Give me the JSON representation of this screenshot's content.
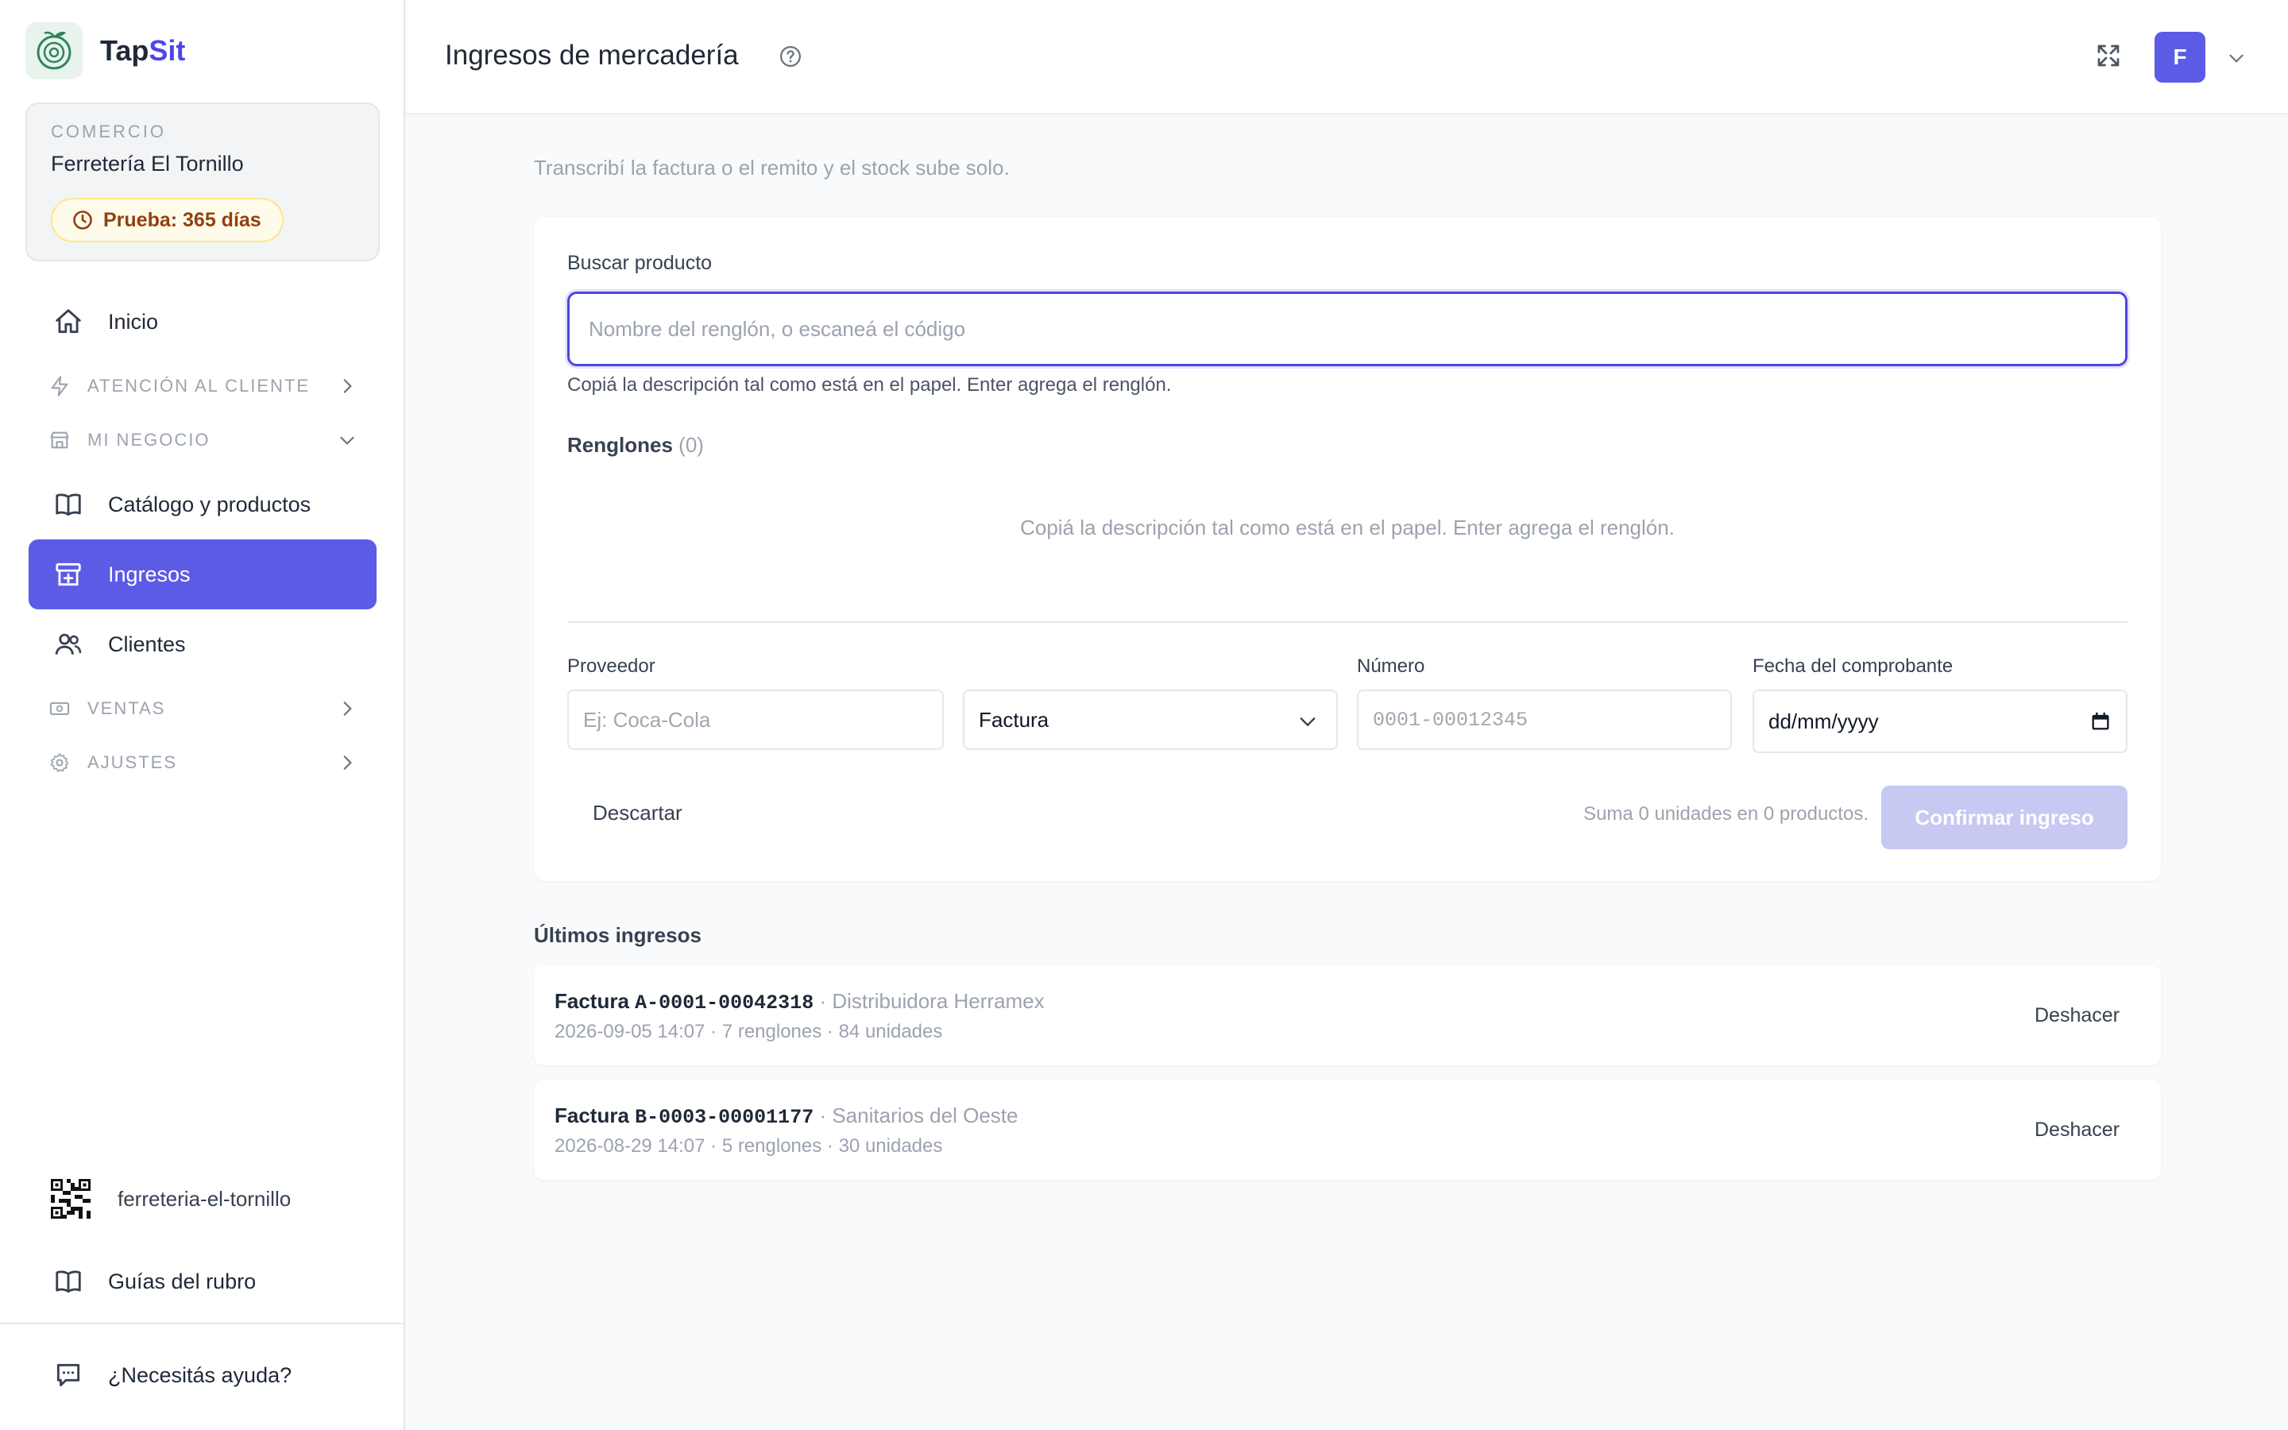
{
  "brand": {
    "name_part1": "Tap",
    "name_part2": "Sit"
  },
  "store": {
    "label": "COMERCIO",
    "name": "Ferretería El Tornillo",
    "trial": "Prueba: 365 días"
  },
  "nav": {
    "inicio": "Inicio",
    "atencion": "ATENCIÓN AL CLIENTE",
    "negocio": "MI NEGOCIO",
    "catalogo": "Catálogo y productos",
    "ingresos": "Ingresos",
    "clientes": "Clientes",
    "ventas": "VENTAS",
    "ajustes": "AJUSTES"
  },
  "sidebar_footer": {
    "slug": "ferreteria-el-tornillo",
    "guides": "Guías del rubro",
    "help": "¿Necesitás ayuda?"
  },
  "header": {
    "title": "Ingresos de mercadería",
    "avatar": "F"
  },
  "main": {
    "subtitle": "Transcribí la factura o el remito y el stock sube solo.",
    "search_label": "Buscar producto",
    "search_placeholder": "Nombre del renglón, o escaneá el código",
    "search_value": "",
    "hint": "Copiá la descripción tal como está en el papel. Enter agrega el renglón.",
    "rows_title": "Renglones",
    "rows_count": "(0)",
    "empty_message": "Copiá la descripción tal como está en el papel. Enter agrega el renglón.",
    "supplier_label": "Proveedor",
    "supplier_placeholder": "Ej: Coca-Cola",
    "doc_type_value": "Factura",
    "number_label": "Número",
    "number_placeholder": "0001-00012345",
    "date_label": "Fecha del comprobante",
    "date_placeholder": "dd/mm/yyyy",
    "discard": "Descartar",
    "summary": "Suma 0 unidades en 0 productos.",
    "confirm": "Confirmar ingreso"
  },
  "recent": {
    "title": "Últimos ingresos",
    "items": [
      {
        "kind": "Factura",
        "number": "A-0001-00042318",
        "sep": "·",
        "supplier": "Distribuidora Herramex",
        "meta": "2026-09-05 14:07 · 7 renglones · 84 unidades",
        "undo": "Deshacer"
      },
      {
        "kind": "Factura",
        "number": "B-0003-00001177",
        "sep": "·",
        "supplier": "Sanitarios del Oeste",
        "meta": "2026-08-29 14:07 · 5 renglones · 30 unidades",
        "undo": "Deshacer"
      }
    ]
  },
  "colors": {
    "accent": "#5b5be6",
    "brand_green": "#2f855a",
    "trial_bg": "#fffbeb",
    "confirm_disabled": "#c7c9f3"
  },
  "icons": {
    "logo": "leaf-logo-icon",
    "inicio": "home-icon",
    "atencion": "bolt-icon",
    "negocio": "store-icon",
    "catalogo": "book-open-icon",
    "ingresos": "archive-plus-icon",
    "clientes": "users-icon",
    "ventas": "cash-icon",
    "ajustes": "gear-icon",
    "help": "question-circle-icon",
    "expand": "expand-icon"
  }
}
